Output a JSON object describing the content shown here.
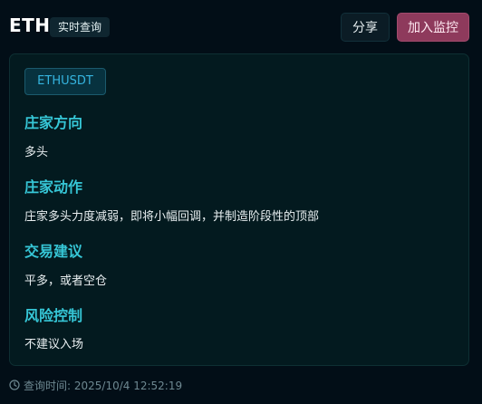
{
  "header": {
    "symbol": "ETH",
    "tag": "实时查询",
    "share_label": "分享",
    "monitor_label": "加入监控"
  },
  "card": {
    "pair": "ETHUSDT",
    "sections": [
      {
        "title": "庄家方向",
        "body": "多头"
      },
      {
        "title": "庄家动作",
        "body": "庄家多头力度减弱，即将小幅回调，并制造阶段性的顶部"
      },
      {
        "title": "交易建议",
        "body": "平多，或者空仓"
      },
      {
        "title": "风险控制",
        "body": "不建议入场"
      }
    ]
  },
  "footer": {
    "query_time": "查询时间: 2025/10/4 12:52:19",
    "icon": "clock-icon"
  },
  "colors": {
    "background": "#020e17",
    "accent_title": "#36c6d6",
    "monitor_button": "#8e3a5c",
    "pair_chip_text": "#35b4df"
  }
}
